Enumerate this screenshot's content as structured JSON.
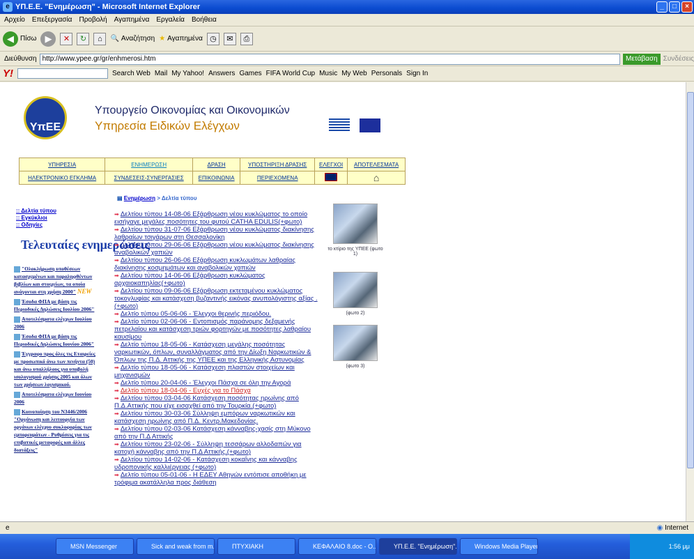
{
  "window": {
    "title": "ΥΠ.Ε.Ε. \"Ενημέρωση\" - Microsoft Internet Explorer"
  },
  "menu": [
    "Αρχείο",
    "Επεξεργασία",
    "Προβολή",
    "Αγαπημένα",
    "Εργαλεία",
    "Βοήθεια"
  ],
  "toolbar": {
    "back": "Πίσω",
    "search": "Αναζήτηση",
    "favorites": "Αγαπημένα"
  },
  "address": {
    "label": "Διεύθυνση",
    "url": "http://www.ypee.gr/gr/enhmerosi.htm",
    "go": "Μετάβαση",
    "links": "Συνδέσεις"
  },
  "yahoo": {
    "logo": "Y!",
    "search_btn": "Search Web",
    "items": [
      "Mail",
      "My Yahoo!",
      "Answers",
      "Games",
      "FIFA World Cup",
      "Music",
      "My Web",
      "Personals",
      "Sign In"
    ]
  },
  "site": {
    "logo_text": "ΥπΕΕ",
    "ministry": "Υπουργείο Οικονομίας και Οικονομικών",
    "service": "Υπηρεσία Ειδικών Ελέγχων",
    "nav_row1": [
      "ΥΠΗΡΕΣΙΑ",
      "ΕΝΗΜΕΡΩΣΗ",
      "ΔΡΑΣΗ",
      "ΥΠΟΣΤΗΡΙΞΗ ΔΡΑΣΗΣ",
      "ΕΛΕΓΧΟΙ",
      "ΑΠΟΤΕΛΕΣΜΑΤΑ"
    ],
    "nav_row2": [
      "ΗΛΕΚΤΡΟΝΙΚΟ ΕΓΚΛΗΜΑ",
      "ΣΥΝΔΕΣΕΙΣ-ΣΥΝΕΡΓΑΣΙΕΣ",
      "ΕΠΙΚΟΙΝΩΝΙΑ",
      "ΠΕΡΙΕΧΟΜΕΝΑ"
    ],
    "left_links": [
      ":: Δελτία τύπου",
      ":: Εγκύκλιοι",
      ":: Οδηγίες"
    ],
    "latest_title": "Τελευταίες ενημερώσεις",
    "latest": [
      "\"Ολοκλήρωση υποθέσεων κατασχεμένων και παραληφθέντων βιβλίων και στοιχείων, τα οποία ανάγονται στη χρήση 2000\"",
      "Έσοδα ΦΠΑ με βάση τις Περιοδικές Δηλώσεις Ιουλίου 2006\"",
      "Αποτελέσματα ελέγχων Ιουλίου 2006",
      "Έσοδα ΦΠΑ με βάση τις Περιοδικές Δηλώσεις Ιουνίου 2006\"",
      "Έγγραφο προς όλες τις Εταιρείες με προσωπικό άνω των πενήντα (50) και άνω υπαλλήλους για υποβολή ισολογισμού χρήσης 2005 και όλων των χρήσεων λογισμικού.",
      "Αποτελέσματα ελέγχων Ιουνίου 2006",
      "Κοινοποίηση του Ν3446/2006 \"Οργάνωση και λειτουργία των οργάνων ελέγχου συκλοφορίας των εμπορευμάτων - Ρυθμίσεις για τις επιβατικές μεταφορές και άλλες διατάξεις\""
    ],
    "new_badge": "NEW",
    "breadcrumb_link": "Ενημέρωση",
    "breadcrumb_rest": " > Δελτία τύπου",
    "press": [
      "Δελτίου τύπου 14-08-06 Εξάρθρωση νέου κυκλώματος το οποίο εισήγαγε μεγάλες ποσότητες του φυτού CATHA EDULIS(+φωτο)",
      "Δελτίου τύπου 31-07-06 Εξάρθρωση νέου κυκλώματος διακίνησης λαθραίων τσιγάρων στη Θεσσαλονίκη",
      "Δελτίου τύπου 29-06-06 Εξάρθρωση νέου κυκλώματος διακίνησης αναβολικών χαπιών",
      "Δελτίου τύπου 26-06-06 Εξάρθρωση κυκλωμάτων λαθραίας διακίνησης κοσμημάτων και αναβολικών χαπιών",
      "Δελτίου τύπου 14-06-06 Εξάρθρωση κυκλώματος αρχαιοκαπηλίας(+φωτο)",
      "Δελτίου τύπου 09-06-06 Εξάρθρωση εκτεταμένου κυκλώματος τοκογλυφίας και κατάσχεση βυζαντινής εικόνας ανυπολόγιστης αξίας .(+φωτο)",
      "Δελτίο τύπου 05-06-06 - Έλεγχοι θερινής περιόδου.",
      "Δελτίο τύπου 02-06-06 - Εντοπισμός παράνομης δεξαμενής πετρελαίου και κατάσχεση τριών φορτηγών με ποσότητες λαθραίου καυσίμου",
      "Δελτίο τύπου 18-05-06 - Κατάσχεση μεγάλης ποσότητας ναρκωτικών, όπλων, συναλλάγματος από την Δίωξη Ναρκωτικών & Όπλων της Π.Δ. Αττικής της ΥΠΕΕ και της Ελληνικής Αστυνομίας",
      "Δελτίο τύπου 18-05-06 - Κατάσχεση πλαστών στοιχείων και μηχανισμών",
      "Δελτίο τύπου 20-04-06 - Έλεγχοι Πάσχα σε όλη την Αγορά",
      "Δελτίο τύπου 18-04-06 - Ευχές για το Πάσχα",
      "Δελτίου τύπου 03-04-06 Κατάσχεση ποσότητας ηρωίνης από Π.Δ.Αττικής που είχε εισαχθεί από την Τουρκία.(+φωτο)",
      "Δελτίου τύπου 30-03-06 Σύλληψη εμπόρων ναρκωτικών και κατάσχεση ηρωίνης από Π.Δ. Κεντρ.Μακεδονίας.",
      "Δελτίου τύπου 02-03-06 Κατάσχεση κάνναβης-χασίς στη Μύκονο από την Π.Δ Αττικής",
      "Δελτίου τύπου 23-02-06 - Σύλληψη τεσσάρων αλλοδαπών για κατοχή κάνναβης από την Π.Δ Αττικής.(+φωτο)",
      "Δελτίου τύπου 14-02-06 - Κατάσχεση κοκαΐνης και κάνναβης υδροπονικής καλλιέργειας (+φωτο)",
      "Δελτίο τύπου 05-01-06 - Η ΕΔΕΥ Αθηνών εντόπισε αποθήκη με τρόφιμα ακατάλληλα προς διάθεση"
    ],
    "photo1_cap": "το κτίριο της ΥΠΕΕ (φωτο 1)",
    "photo2_cap": "(φωτο 2)",
    "photo3_cap": "(φωτο 3)"
  },
  "status": {
    "left": "",
    "zone": "Internet"
  },
  "taskbar": {
    "items": [
      "MSN Messenger",
      "Sick and weak from m...",
      "ΠΤΥΧΙΑΚΗ",
      "ΚΕΦΑΛΑΙΟ 8.doc - O...",
      "ΥΠ.Ε.Ε. \"Ενημέρωση\"...",
      "Windows Media Player"
    ],
    "clock": "1:56 μμ"
  }
}
